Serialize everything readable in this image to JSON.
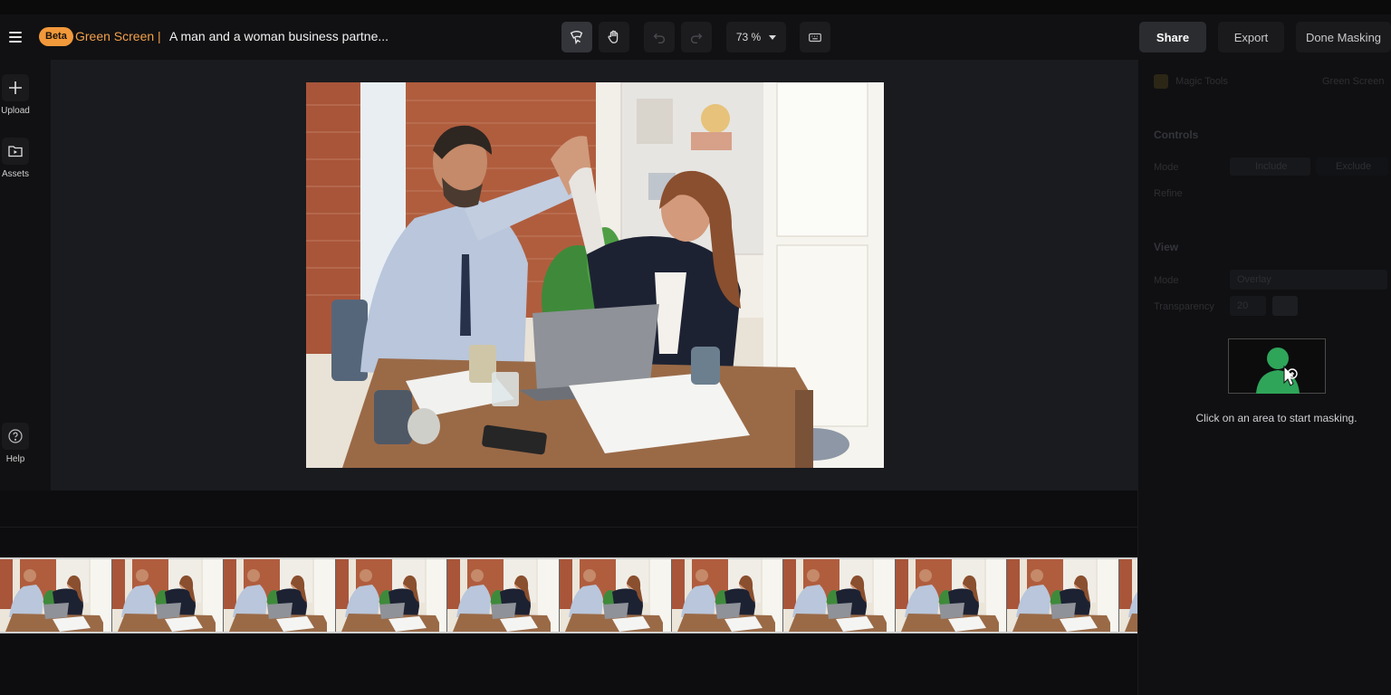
{
  "header": {
    "badge": "Beta",
    "project_type": "Green Screen |",
    "project_title": "A man and a woman business partne...",
    "zoom": "73 %",
    "share_label": "Share",
    "export_label": "Export",
    "done_label": "Done Masking"
  },
  "tools": [
    "mask-select-icon",
    "hand-icon",
    "undo-icon",
    "redo-icon",
    "keyboard-icon"
  ],
  "sidebar": {
    "items": [
      {
        "label": "Upload",
        "icon": "plus-icon"
      },
      {
        "label": "Assets",
        "icon": "folder-icon"
      },
      {
        "label": "Help",
        "icon": "question-icon"
      }
    ]
  },
  "panel": {
    "title": "Magic Tools",
    "subtitle": "Green Screen",
    "controls_heading": "Controls",
    "mode_label": "Mode",
    "include_label": "Include",
    "exclude_label": "Exclude",
    "refine_label": "Refine",
    "view_heading": "View",
    "view_mode_label": "Mode",
    "view_mode_value": "Overlay",
    "transparency_label": "Transparency",
    "transparency_value": "20",
    "hint": "Click on an area to start masking."
  },
  "colors": {
    "accent": "#f2993b",
    "mask_green": "#2fa55a"
  },
  "timeline": {
    "frame_count": 11
  }
}
